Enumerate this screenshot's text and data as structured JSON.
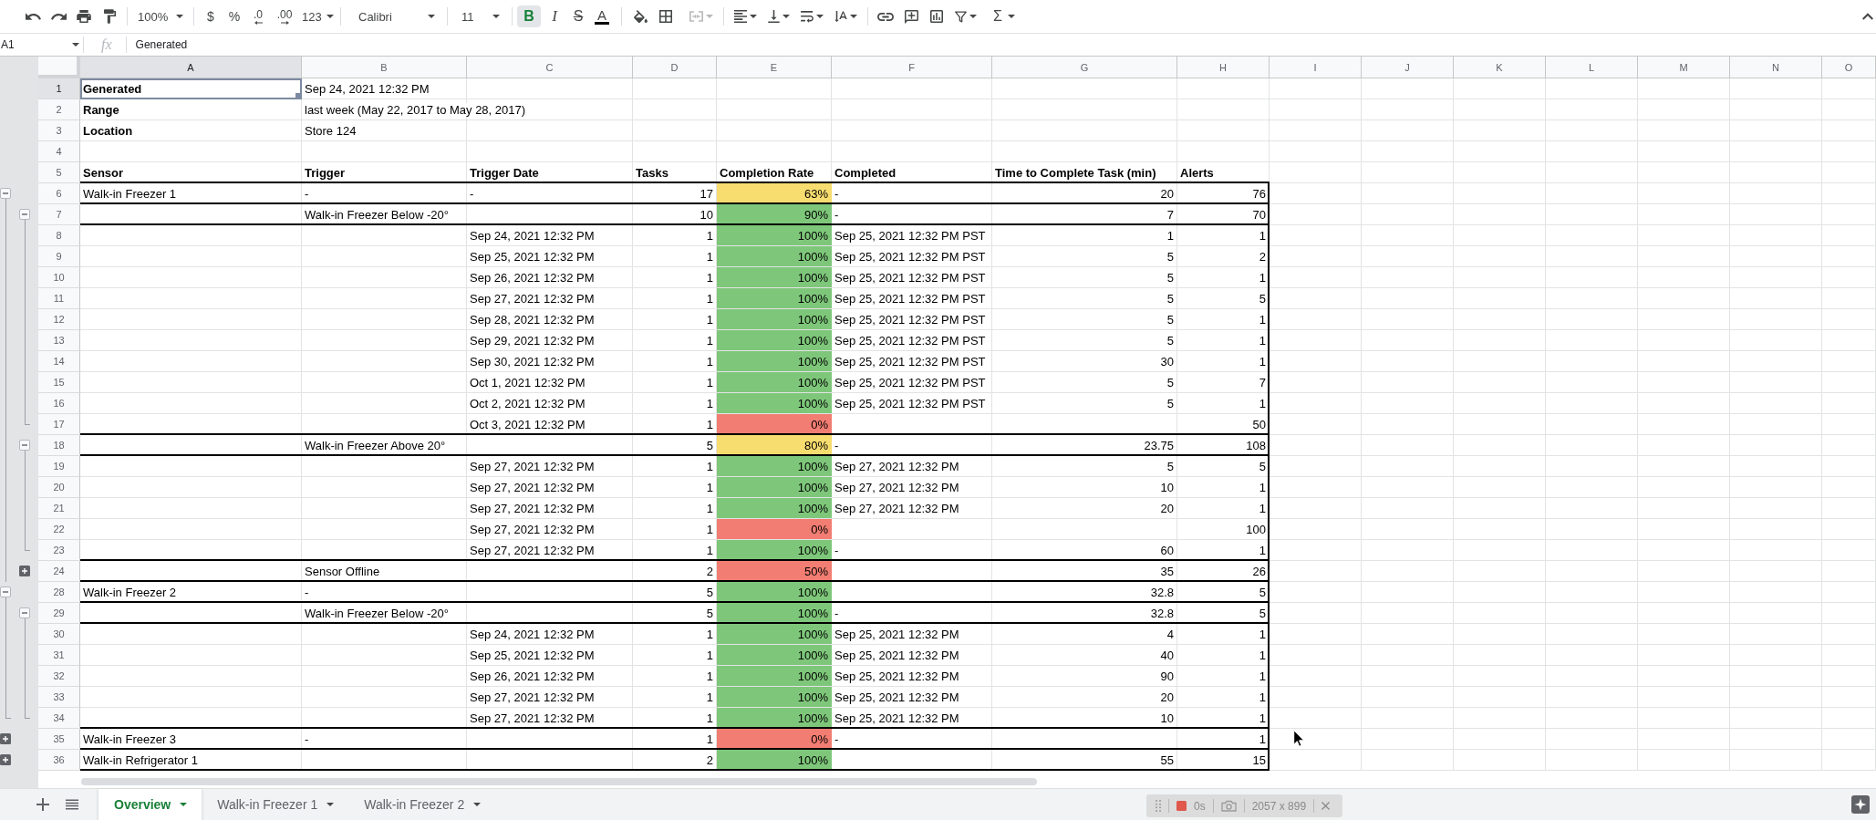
{
  "toolbar": {
    "zoom": "100%",
    "currency": "$",
    "percent": "%",
    "decrease_decimals": ".0",
    "increase_decimals": ".00",
    "number_format": "123",
    "font": "Calibri",
    "font_size": "11",
    "bold": {
      "label": "B",
      "on": true
    },
    "italic": {
      "label": "I",
      "on": false
    },
    "strikethrough": {
      "label": "S",
      "on": false
    },
    "text_color": "A",
    "merge": {
      "disabled": true
    },
    "functions": "Σ"
  },
  "formula_bar": {
    "name_box": "A1",
    "function_label": "fx",
    "formula": "Generated"
  },
  "table": {
    "columns": [
      {
        "label": "A",
        "selected": true
      },
      {
        "label": "B",
        "selected": false
      },
      {
        "label": "C",
        "selected": false
      },
      {
        "label": "D",
        "selected": false
      },
      {
        "label": "E",
        "selected": false
      },
      {
        "label": "F",
        "selected": false
      },
      {
        "label": "G",
        "selected": false
      },
      {
        "label": "H",
        "selected": false
      },
      {
        "label": "I",
        "selected": false
      },
      {
        "label": "J",
        "selected": false
      },
      {
        "label": "K",
        "selected": false
      },
      {
        "label": "L",
        "selected": false
      },
      {
        "label": "M",
        "selected": false
      },
      {
        "label": "N",
        "selected": false
      },
      {
        "label": "O",
        "selected": false
      }
    ],
    "rows": [
      {
        "number": "1",
        "kind": "info",
        "selected": true,
        "label": "Generated",
        "value": "Sep 24, 2021 12:32 PM"
      },
      {
        "number": "2",
        "kind": "info",
        "selected": false,
        "label": "Range",
        "value": "last week (May 22, 2017 to May 28, 2017)"
      },
      {
        "number": "3",
        "kind": "info",
        "selected": false,
        "label": "Location",
        "value": "Store 124"
      },
      {
        "number": "4",
        "kind": "info",
        "selected": false
      },
      {
        "number": "5",
        "kind": "header",
        "selected": false,
        "headings": [
          "Sensor",
          "Trigger",
          "Trigger Date",
          "Tasks",
          "Completion Rate",
          "Completed",
          "Time to Complete Task (min)",
          "Alerts"
        ]
      },
      {
        "number": "6",
        "kind": "summary",
        "selected": false,
        "expanded": true,
        "color": "#f7dc6f",
        "cells": {
          "sensor": "Walk-in Freezer 1",
          "trigger": "-",
          "trigger_date": "-",
          "tasks": "17",
          "completion_rate": "63%",
          "completed": "-",
          "time_to_complete": "20",
          "alerts": "76"
        },
        "children": [
          {
            "number": "7",
            "kind": "summary",
            "selected": false,
            "expanded": true,
            "color": "#7ec77a",
            "cells": {
              "trigger": "Walk-in Freezer Below -20°",
              "tasks": "10",
              "completion_rate": "90%",
              "completed": "-",
              "time_to_complete": "7",
              "alerts": "70"
            },
            "children": [
              {
                "number": "8",
                "kind": "detail",
                "selected": false,
                "color": "#7ec77a",
                "cells": {
                  "trigger_date": "Sep 24, 2021 12:32 PM",
                  "tasks": "1",
                  "completion_rate": "100%",
                  "completed": "Sep 25, 2021 12:32 PM PST",
                  "time_to_complete": "1",
                  "alerts": "1"
                }
              },
              {
                "number": "9",
                "kind": "detail",
                "selected": false,
                "color": "#7ec77a",
                "cells": {
                  "trigger_date": "Sep 25, 2021 12:32 PM",
                  "tasks": "1",
                  "completion_rate": "100%",
                  "completed": "Sep 25, 2021 12:32 PM PST",
                  "time_to_complete": "5",
                  "alerts": "2"
                }
              },
              {
                "number": "10",
                "kind": "detail",
                "selected": false,
                "color": "#7ec77a",
                "cells": {
                  "trigger_date": "Sep 26, 2021 12:32 PM",
                  "tasks": "1",
                  "completion_rate": "100%",
                  "completed": "Sep 25, 2021 12:32 PM PST",
                  "time_to_complete": "5",
                  "alerts": "1"
                }
              },
              {
                "number": "11",
                "kind": "detail",
                "selected": false,
                "color": "#7ec77a",
                "cells": {
                  "trigger_date": "Sep 27, 2021 12:32 PM",
                  "tasks": "1",
                  "completion_rate": "100%",
                  "completed": "Sep 25, 2021 12:32 PM PST",
                  "time_to_complete": "5",
                  "alerts": "5"
                }
              },
              {
                "number": "12",
                "kind": "detail",
                "selected": false,
                "color": "#7ec77a",
                "cells": {
                  "trigger_date": "Sep 28, 2021 12:32 PM",
                  "tasks": "1",
                  "completion_rate": "100%",
                  "completed": "Sep 25, 2021 12:32 PM PST",
                  "time_to_complete": "5",
                  "alerts": "1"
                }
              },
              {
                "number": "13",
                "kind": "detail",
                "selected": false,
                "color": "#7ec77a",
                "cells": {
                  "trigger_date": "Sep 29, 2021 12:32 PM",
                  "tasks": "1",
                  "completion_rate": "100%",
                  "completed": "Sep 25, 2021 12:32 PM PST",
                  "time_to_complete": "5",
                  "alerts": "1"
                }
              },
              {
                "number": "14",
                "kind": "detail",
                "selected": false,
                "color": "#7ec77a",
                "cells": {
                  "trigger_date": "Sep 30, 2021 12:32 PM",
                  "tasks": "1",
                  "completion_rate": "100%",
                  "completed": "Sep 25, 2021 12:32 PM PST",
                  "time_to_complete": "30",
                  "alerts": "1"
                }
              },
              {
                "number": "15",
                "kind": "detail",
                "selected": false,
                "color": "#7ec77a",
                "cells": {
                  "trigger_date": "Oct 1, 2021 12:32 PM",
                  "tasks": "1",
                  "completion_rate": "100%",
                  "completed": "Sep 25, 2021 12:32 PM PST",
                  "time_to_complete": "5",
                  "alerts": "7"
                }
              },
              {
                "number": "16",
                "kind": "detail",
                "selected": false,
                "color": "#7ec77a",
                "cells": {
                  "trigger_date": "Oct 2, 2021 12:32 PM",
                  "tasks": "1",
                  "completion_rate": "100%",
                  "completed": "Sep 25, 2021 12:32 PM PST",
                  "time_to_complete": "5",
                  "alerts": "1"
                }
              },
              {
                "number": "17",
                "kind": "detail",
                "selected": false,
                "color": "#f27d72",
                "cells": {
                  "trigger_date": "Oct 3, 2021 12:32 PM",
                  "tasks": "1",
                  "completion_rate": "0%",
                  "alerts": "50"
                }
              }
            ]
          },
          {
            "number": "18",
            "kind": "summary",
            "selected": false,
            "expanded": true,
            "color": "#f7dc6f",
            "cells": {
              "trigger": "Walk-in Freezer Above 20°",
              "tasks": "5",
              "completion_rate": "80%",
              "completed": "-",
              "time_to_complete": "23.75",
              "alerts": "108"
            },
            "children": [
              {
                "number": "19",
                "kind": "detail",
                "selected": false,
                "color": "#7ec77a",
                "cells": {
                  "trigger_date": "Sep 27, 2021 12:32 PM",
                  "tasks": "1",
                  "completion_rate": "100%",
                  "completed": "Sep 27, 2021 12:32 PM",
                  "time_to_complete": "5",
                  "alerts": "5"
                }
              },
              {
                "number": "20",
                "kind": "detail",
                "selected": false,
                "color": "#7ec77a",
                "cells": {
                  "trigger_date": "Sep 27, 2021 12:32 PM",
                  "tasks": "1",
                  "completion_rate": "100%",
                  "completed": "Sep 27, 2021 12:32 PM",
                  "time_to_complete": "10",
                  "alerts": "1"
                }
              },
              {
                "number": "21",
                "kind": "detail",
                "selected": false,
                "color": "#7ec77a",
                "cells": {
                  "trigger_date": "Sep 27, 2021 12:32 PM",
                  "tasks": "1",
                  "completion_rate": "100%",
                  "completed": "Sep 27, 2021 12:32 PM",
                  "time_to_complete": "20",
                  "alerts": "1"
                }
              },
              {
                "number": "22",
                "kind": "detail",
                "selected": false,
                "color": "#f27d72",
                "cells": {
                  "trigger_date": "Sep 27, 2021 12:32 PM",
                  "tasks": "1",
                  "completion_rate": "0%",
                  "alerts": "100"
                }
              },
              {
                "number": "23",
                "kind": "detail",
                "selected": false,
                "color": "#7ec77a",
                "cells": {
                  "trigger_date": "Sep 27, 2021 12:32 PM",
                  "tasks": "1",
                  "completion_rate": "100%",
                  "completed": "-",
                  "time_to_complete": "60",
                  "alerts": "1"
                }
              }
            ]
          },
          {
            "number": "24",
            "kind": "summary",
            "selected": false,
            "expanded": false,
            "color": "#f27d72",
            "cells": {
              "trigger": "Sensor Offline",
              "tasks": "2",
              "completion_rate": "50%",
              "time_to_complete": "35",
              "alerts": "26"
            }
          }
        ]
      },
      {
        "number": "28",
        "kind": "summary",
        "selected": false,
        "expanded": true,
        "color": "#7ec77a",
        "cells": {
          "sensor": "Walk-in Freezer 2",
          "trigger": "-",
          "tasks": "5",
          "completion_rate": "100%",
          "time_to_complete": "32.8",
          "alerts": "5"
        },
        "children": [
          {
            "number": "29",
            "kind": "summary",
            "selected": false,
            "expanded": true,
            "color": "#7ec77a",
            "cells": {
              "trigger": "Walk-in Freezer Below -20°",
              "tasks": "5",
              "completion_rate": "100%",
              "completed": "-",
              "time_to_complete": "32.8",
              "alerts": "5"
            },
            "children": [
              {
                "number": "30",
                "kind": "detail",
                "selected": false,
                "color": "#7ec77a",
                "cells": {
                  "trigger_date": "Sep 24, 2021 12:32 PM",
                  "tasks": "1",
                  "completion_rate": "100%",
                  "completed": "Sep 25, 2021 12:32 PM",
                  "time_to_complete": "4",
                  "alerts": "1"
                }
              },
              {
                "number": "31",
                "kind": "detail",
                "selected": false,
                "color": "#7ec77a",
                "cells": {
                  "trigger_date": "Sep 25, 2021 12:32 PM",
                  "tasks": "1",
                  "completion_rate": "100%",
                  "completed": "Sep 25, 2021 12:32 PM",
                  "time_to_complete": "40",
                  "alerts": "1"
                }
              },
              {
                "number": "32",
                "kind": "detail",
                "selected": false,
                "color": "#7ec77a",
                "cells": {
                  "trigger_date": "Sep 26, 2021 12:32 PM",
                  "tasks": "1",
                  "completion_rate": "100%",
                  "completed": "Sep 25, 2021 12:32 PM",
                  "time_to_complete": "90",
                  "alerts": "1"
                }
              },
              {
                "number": "33",
                "kind": "detail",
                "selected": false,
                "color": "#7ec77a",
                "cells": {
                  "trigger_date": "Sep 27, 2021 12:32 PM",
                  "tasks": "1",
                  "completion_rate": "100%",
                  "completed": "Sep 25, 2021 12:32 PM",
                  "time_to_complete": "20",
                  "alerts": "1"
                }
              },
              {
                "number": "34",
                "kind": "detail",
                "selected": false,
                "color": "#7ec77a",
                "cells": {
                  "trigger_date": "Sep 27, 2021 12:32 PM",
                  "tasks": "1",
                  "completion_rate": "100%",
                  "completed": "Sep 25, 2021 12:32 PM",
                  "time_to_complete": "10",
                  "alerts": "1"
                }
              }
            ]
          }
        ]
      },
      {
        "number": "35",
        "kind": "summary",
        "selected": false,
        "expanded": false,
        "color": "#f27d72",
        "cells": {
          "sensor": "Walk-in Freezer 3",
          "trigger": "-",
          "tasks": "1",
          "completion_rate": "0%",
          "completed": "-",
          "alerts": "1"
        }
      },
      {
        "number": "36",
        "kind": "summary",
        "selected": false,
        "expanded": false,
        "color": "#7ec77a",
        "cells": {
          "sensor": "Walk-in Refrigerator 1",
          "tasks": "2",
          "completion_rate": "100%",
          "time_to_complete": "55",
          "alerts": "15"
        }
      }
    ]
  },
  "sheet_tabs": [
    {
      "label": "Overview",
      "selected": true
    },
    {
      "label": "Walk-in Freezer 1",
      "selected": false
    },
    {
      "label": "Walk-in Freezer 2",
      "selected": false
    }
  ],
  "recorder": {
    "elapsed": "0s",
    "dimensions": "2057 x 899"
  }
}
